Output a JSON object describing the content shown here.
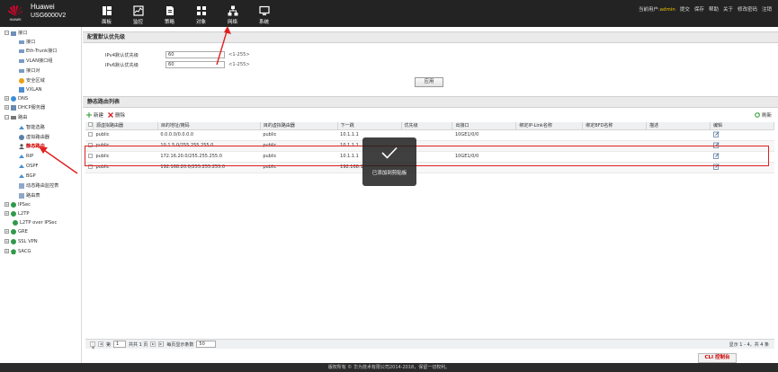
{
  "header": {
    "brand": "Huawei",
    "model": "USG6000V2",
    "nav": [
      {
        "label": "面板",
        "icon": "dashboard-icon"
      },
      {
        "label": "监控",
        "icon": "monitor-icon"
      },
      {
        "label": "策略",
        "icon": "policy-icon"
      },
      {
        "label": "对象",
        "icon": "object-icon"
      },
      {
        "label": "网络",
        "icon": "network-icon"
      },
      {
        "label": "系统",
        "icon": "system-icon"
      }
    ],
    "current_user_label": "当前用户:",
    "current_user": "admin",
    "links": [
      "提交",
      "保存",
      "帮助",
      "关于",
      "修改密码",
      "注销"
    ]
  },
  "sidebar": {
    "items": [
      {
        "label": "接口",
        "exp": "-"
      },
      {
        "label": "接口"
      },
      {
        "label": "Eth-Trunk接口"
      },
      {
        "label": "VLAN接口组"
      },
      {
        "label": "接口对"
      },
      {
        "label": "安全区域"
      },
      {
        "label": "VXLAN"
      },
      {
        "label": "DNS",
        "exp": "+"
      },
      {
        "label": "DHCP服务器",
        "exp": "+"
      },
      {
        "label": "路由",
        "exp": "-"
      },
      {
        "label": "智能选路"
      },
      {
        "label": "虚拟路由器"
      },
      {
        "label": "静态路由"
      },
      {
        "label": "RIP"
      },
      {
        "label": "OSPF"
      },
      {
        "label": "BGP"
      },
      {
        "label": "动态路由监控表"
      },
      {
        "label": "路由表"
      },
      {
        "label": "IPSec",
        "exp": "+"
      },
      {
        "label": "L2TP",
        "exp": "+"
      },
      {
        "label": "L2TP over IPSec"
      },
      {
        "label": "GRE",
        "exp": "+"
      },
      {
        "label": "SSL VPN",
        "exp": "+"
      },
      {
        "label": "SACG",
        "exp": "+"
      }
    ]
  },
  "priority": {
    "title": "配置默认优先级",
    "ipv4_label": "IPv4默认优先级",
    "ipv4_value": "60",
    "ipv6_label": "IPv6默认优先级",
    "ipv6_value": "60",
    "hint": "<1-255>",
    "apply": "应用"
  },
  "routes": {
    "title": "静态路由列表",
    "new": "新建",
    "delete": "删除",
    "refresh": "刷新",
    "columns": [
      "源虚拟路由器",
      "目的地址/掩码",
      "目的虚拟路由器",
      "下一跳",
      "优先级",
      "出接口",
      "绑定IP-Link名称",
      "绑定BFD名称",
      "描述",
      "编辑"
    ],
    "rows": [
      [
        "public",
        "0.0.0.0/0.0.0.0",
        "public",
        "10.1.1.1",
        "",
        "10GE1/0/0",
        "",
        "",
        ""
      ],
      [
        "public",
        "10.1.5.0/255.255.255.0",
        "public",
        "10.1.1.1",
        "",
        "",
        "",
        "",
        ""
      ],
      [
        "public",
        "172.16.20.0/255.255.255.0",
        "public",
        "10.1.1.1",
        "",
        "10GE1/0/0",
        "",
        "",
        ""
      ],
      [
        "public",
        "192.168.20.0/255.255.255.0",
        "public",
        "192.168.1",
        "",
        "",
        "",
        "",
        ""
      ]
    ]
  },
  "pager": {
    "page_prefix": "第",
    "page": "1",
    "total_pages": "共共 1 页",
    "per_page_label": "每页显示条数",
    "per_page": "50",
    "info": "显示 1 - 4，共 4 条"
  },
  "toast": "已添加到剪贴板",
  "cli": "CLI 控制台",
  "footer": "版权所有 © 华为技术有限公司2014-2018，保留一切权利。",
  "colors": {
    "accent": "#e02020",
    "header": "#232323",
    "admin": "#f3c300"
  }
}
